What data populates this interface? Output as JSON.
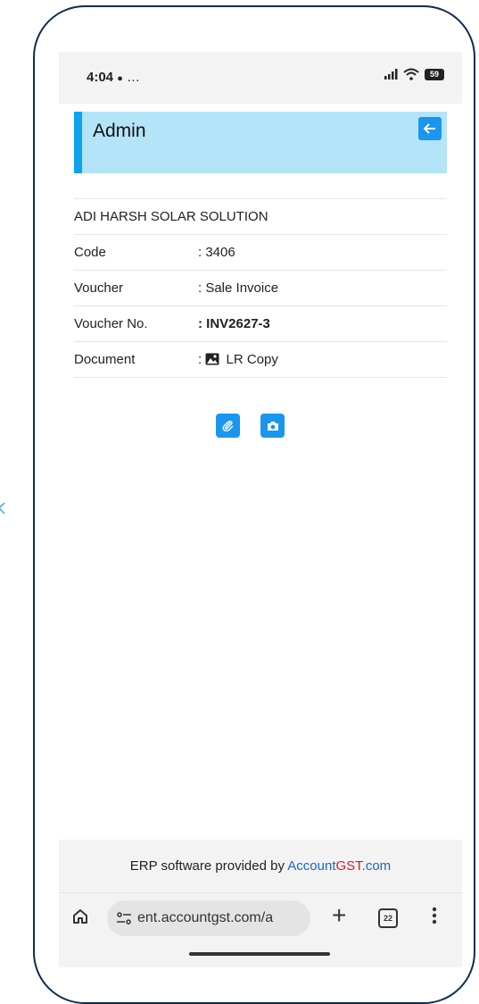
{
  "status": {
    "time": "4:04",
    "notif": "…",
    "battery": "59"
  },
  "header": {
    "title": "Admin"
  },
  "details": {
    "company": "ADI HARSH SOLAR SOLUTION",
    "rows": [
      {
        "label": "Code",
        "value": ": 3406"
      },
      {
        "label": "Voucher",
        "value": ": Sale Invoice"
      },
      {
        "label": "Voucher No.",
        "value": ": INV2627-3"
      },
      {
        "label": "Document",
        "value_prefix": ":",
        "value": "LR Copy"
      }
    ]
  },
  "footer": {
    "text": "ERP software provided by ",
    "brand_part1": "Account",
    "brand_part2": "GST",
    "brand_part3": ".com"
  },
  "browser": {
    "url": "ent.accountgst.com/a",
    "tab_count": "22"
  },
  "colors": {
    "accent": "#1a96ef",
    "header_bg": "#b4e4f8",
    "header_border": "#0ba3ee",
    "brand_blue": "#2065c0",
    "brand_red": "#d31f26"
  }
}
